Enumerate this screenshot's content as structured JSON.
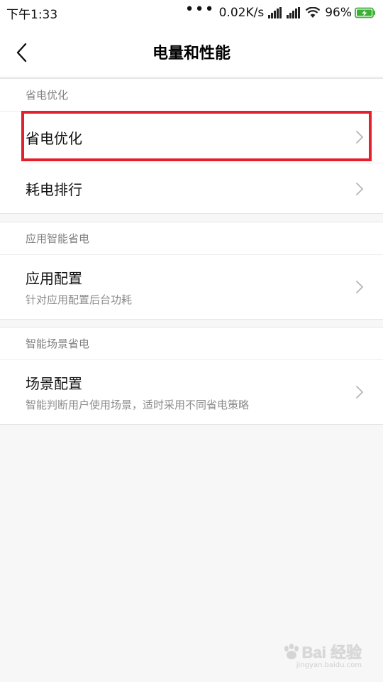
{
  "status_bar": {
    "time": "下午1:33",
    "dots": "•••",
    "net_speed": "0.02K/s",
    "battery_percent": "96%",
    "icons": [
      "signal-icon",
      "signal-icon",
      "wifi-icon",
      "battery-charging-icon"
    ],
    "battery_color": "#3cb034"
  },
  "header": {
    "title": "电量和性能",
    "back_icon": "chevron-left-icon"
  },
  "sections": [
    {
      "header": "省电优化",
      "items": [
        {
          "title": "省电优化",
          "subtitle": ""
        },
        {
          "title": "耗电排行",
          "subtitle": ""
        }
      ]
    },
    {
      "header": "应用智能省电",
      "items": [
        {
          "title": "应用配置",
          "subtitle": "针对应用配置后台功耗"
        }
      ]
    },
    {
      "header": "智能场景省电",
      "items": [
        {
          "title": "场景配置",
          "subtitle": "智能判断用户使用场景，适时采用不同省电策略"
        }
      ]
    }
  ],
  "highlight_color": "#e3212d",
  "watermark": {
    "main": "Bai 经验",
    "sub": "jingyan.baidu.com"
  }
}
